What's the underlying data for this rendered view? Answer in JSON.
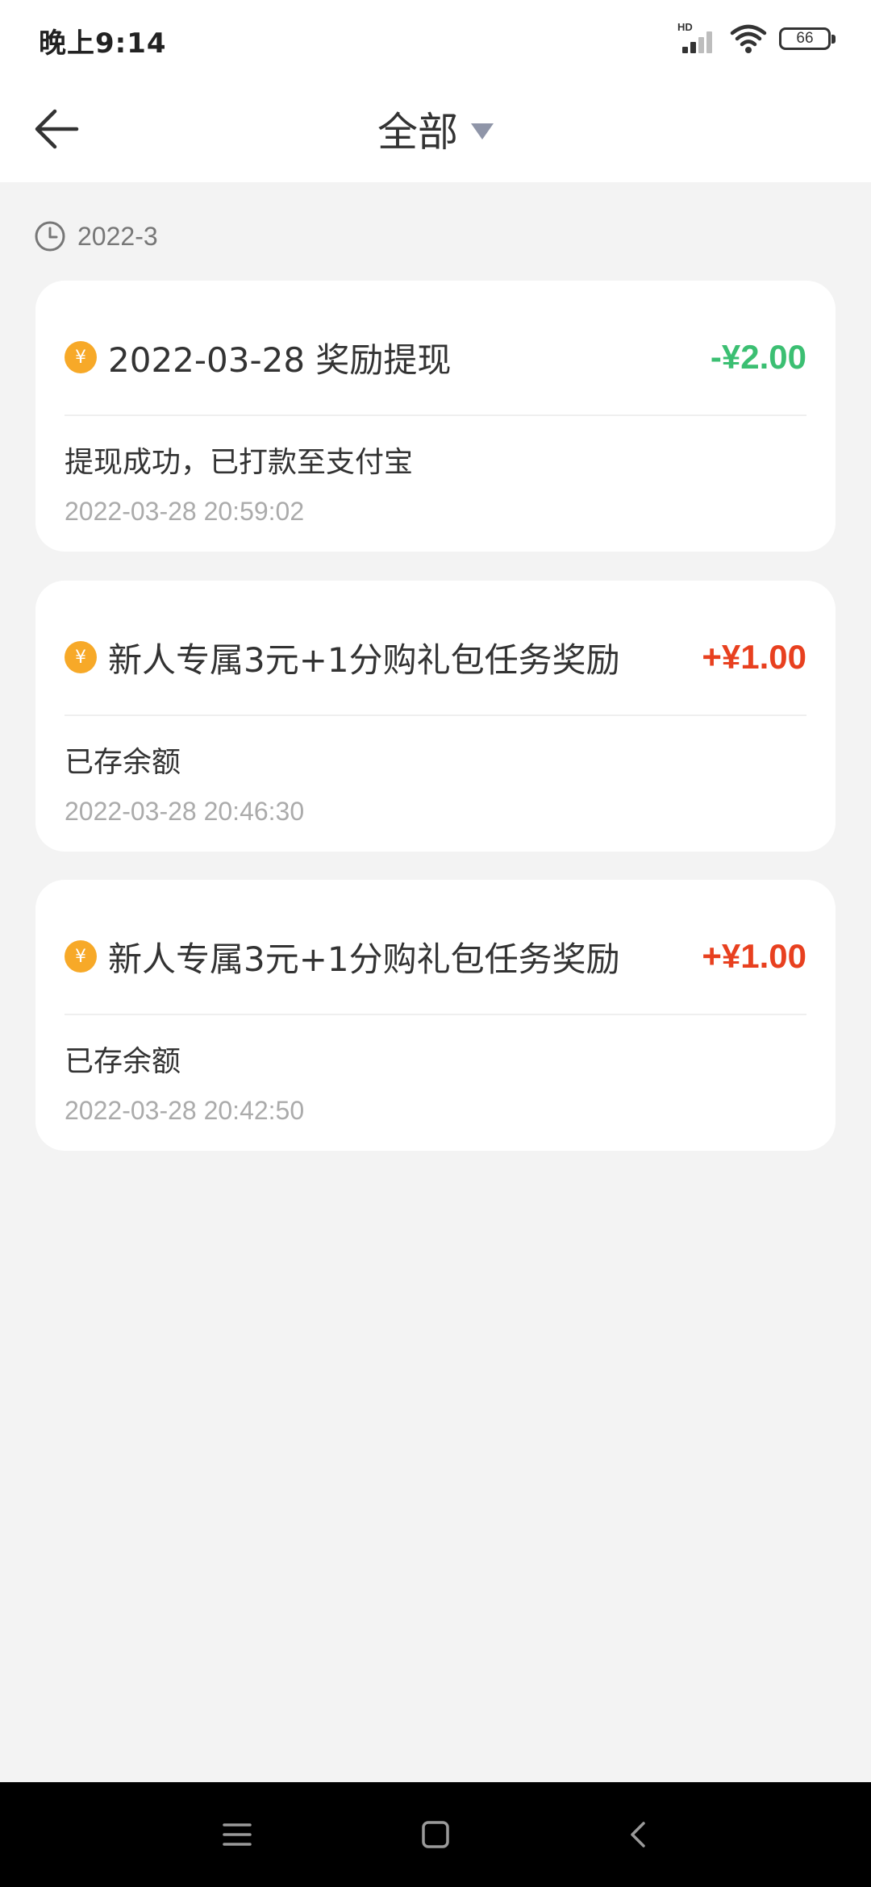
{
  "status_bar": {
    "time": "晚上9:14",
    "network_label": "HD",
    "battery_level": "66",
    "icons": [
      "signal-icon",
      "wifi-icon",
      "battery-icon"
    ]
  },
  "header": {
    "back_icon": "arrow-left-icon",
    "title": "全部",
    "dropdown_icon": "caret-down-icon"
  },
  "month_group": {
    "icon": "clock-icon",
    "label": "2022-3"
  },
  "colors": {
    "negative_amount": "#3bbf72",
    "positive_amount": "#e8401f",
    "coin": "#f7a928"
  },
  "transactions": [
    {
      "title": "2022-03-28 奖励提现",
      "amount": "-¥2.00",
      "direction": "out",
      "description": "提现成功，已打款至支付宝",
      "timestamp": "2022-03-28 20:59:02"
    },
    {
      "title": "新人专属3元+1分购礼包任务奖励",
      "amount": "+¥1.00",
      "direction": "in",
      "description": "已存余额",
      "timestamp": "2022-03-28 20:46:30"
    },
    {
      "title": "新人专属3元+1分购礼包任务奖励",
      "amount": "+¥1.00",
      "direction": "in",
      "description": "已存余额",
      "timestamp": "2022-03-28 20:42:50"
    }
  ],
  "coin_symbol": "¥",
  "nav_bar": {
    "icons": [
      "menu-icon",
      "home-square-icon",
      "back-chevron-icon"
    ]
  }
}
